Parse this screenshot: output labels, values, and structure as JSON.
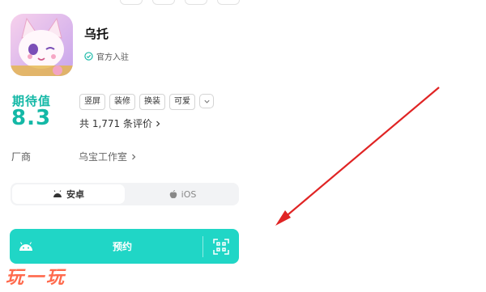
{
  "app": {
    "title": "乌托",
    "official_label": "官方入驻"
  },
  "rating": {
    "label": "期待值",
    "value": "8.3"
  },
  "tags": [
    "竖屏",
    "装修",
    "换装",
    "可爱"
  ],
  "reviews": {
    "text": "共 1,771 条评价"
  },
  "vendor": {
    "label": "厂商",
    "name": "乌宝工作室"
  },
  "platforms": {
    "android": "安卓",
    "ios": "iOS"
  },
  "reserve": {
    "label": "预约"
  },
  "watermark": "玩一玩",
  "colors": {
    "accent": "#14b8a6",
    "button": "#20d6c6",
    "arrow": "#e02424",
    "watermark": "#ff6a4d"
  },
  "icons": {
    "official": "verified-check-icon",
    "more": "chevron-down-icon",
    "review": "chevron-right-icon",
    "vendor": "chevron-right-icon",
    "android": "android-icon",
    "ios": "apple-icon",
    "qr": "qr-scan-icon"
  }
}
